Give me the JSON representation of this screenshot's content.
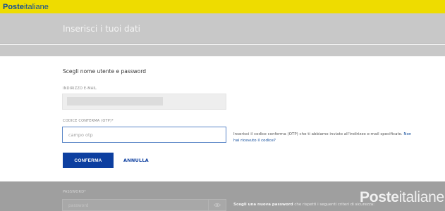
{
  "brand": {
    "logo_bold": "Poste",
    "logo_light": "italiane"
  },
  "header": {
    "title": "Inserisci i tuoi dati"
  },
  "form": {
    "section_title": "Scegli nome utente e password",
    "email_label": "INDIRIZZO E-MAIL",
    "otp_label": "CODICE CONFERMA (OTP)*",
    "otp_placeholder": "campo otp",
    "otp_hint": "Inserisci il codice conferma (OTP) che ti abbiamo inviato all'indirizzo e-mail specificato.",
    "otp_hint_link": "Non hai ricevuto il codice?",
    "confirm_label": "CONFERMA",
    "cancel_label": "ANNULLA",
    "password_label": "PASSWORD*",
    "password_placeholder": "password",
    "password_hint_bold": "Scegli una nuova password",
    "password_hint_rest": "che rispetti i seguenti criteri di sicurezza:"
  },
  "watermark": {
    "bold": "Poste",
    "light": "italiane"
  },
  "colors": {
    "brand_yellow": "#eedc00",
    "brand_blue": "#0d3fa0"
  },
  "icons": {
    "password_toggle": "eye-icon"
  }
}
